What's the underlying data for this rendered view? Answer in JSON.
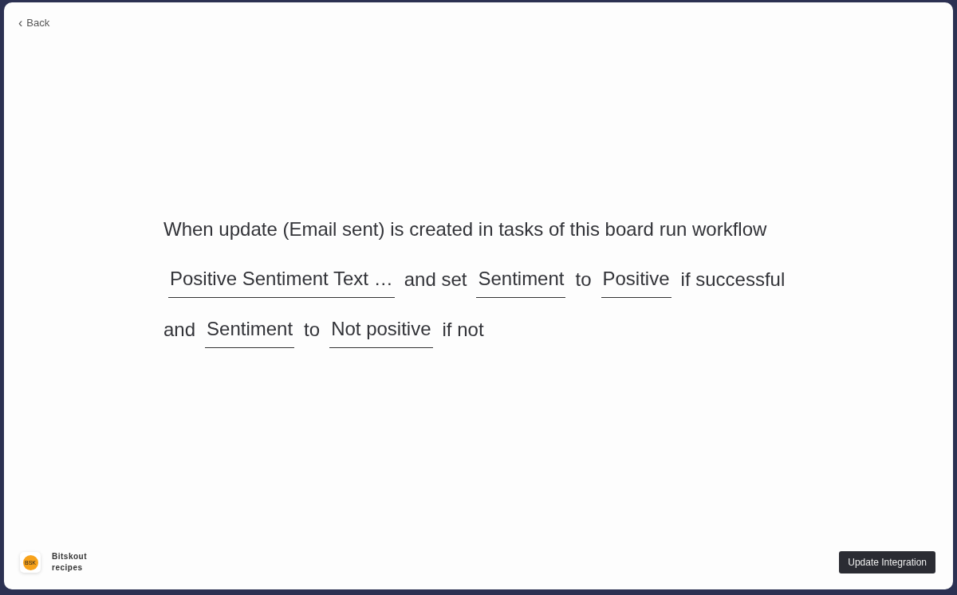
{
  "back": {
    "icon": "‹",
    "label": "Back"
  },
  "sentence": [
    [
      {
        "kind": "text",
        "text": "When update (Email sent) is created in tasks of this board run workflow"
      }
    ],
    [
      {
        "kind": "field",
        "text": "Positive Sentiment Text …"
      },
      {
        "kind": "text",
        "text": "and set"
      },
      {
        "kind": "field",
        "text": "Sentiment"
      },
      {
        "kind": "text",
        "text": "to"
      },
      {
        "kind": "field",
        "text": "Positive"
      },
      {
        "kind": "text",
        "text": "if successful"
      }
    ],
    [
      {
        "kind": "text",
        "text": "and"
      },
      {
        "kind": "field",
        "text": "Sentiment"
      },
      {
        "kind": "text",
        "text": "to"
      },
      {
        "kind": "field",
        "text": "Not positive"
      },
      {
        "kind": "text",
        "text": "if not"
      }
    ]
  ],
  "app": {
    "logo": "BSK",
    "name": "Bitskout recipes"
  },
  "buttons": [
    "Update Integration"
  ]
}
